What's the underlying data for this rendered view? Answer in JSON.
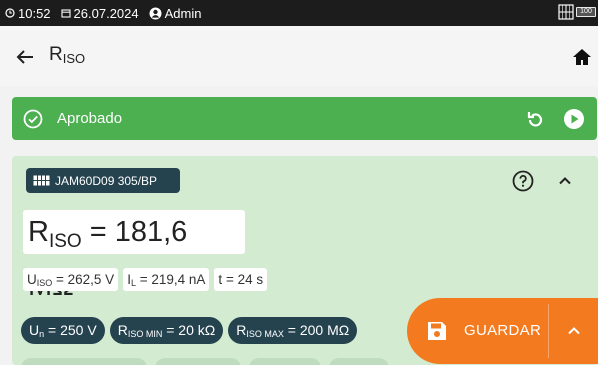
{
  "status": {
    "time": "10:52",
    "date": "26.07.2024",
    "user": "Admin",
    "battery": "100"
  },
  "header": {
    "title_main": "R",
    "title_sub": "ISO"
  },
  "result": {
    "label": "Aprobado",
    "color": "#4caf50"
  },
  "card": {
    "device": "JAM60D09 305/BP",
    "main_symbol": "R",
    "main_sub": "ISO",
    "main_value": " = 181,6 MΩ",
    "chips": [
      {
        "sym": "U",
        "sub": "ISO",
        "val": " = 262,5 V"
      },
      {
        "sym": "I",
        "sub": "L",
        "val": " = 219,4 nA"
      },
      {
        "sym": "t",
        "sub": "",
        "val": " = 24 s"
      }
    ],
    "params": [
      {
        "sym": "U",
        "sub": "n",
        "val": " = 250 V"
      },
      {
        "sym": "R",
        "sub": "ISO MIN",
        "val": " = 20 kΩ"
      },
      {
        "sym": "R",
        "sub": "ISO MAX",
        "val": " = 200 MΩ"
      }
    ]
  },
  "fab": {
    "label": "GUARDAR",
    "color": "#f37a1f"
  },
  "colors": {
    "card_bg": "#d3ebd0",
    "chip_dark": "#25424f"
  }
}
